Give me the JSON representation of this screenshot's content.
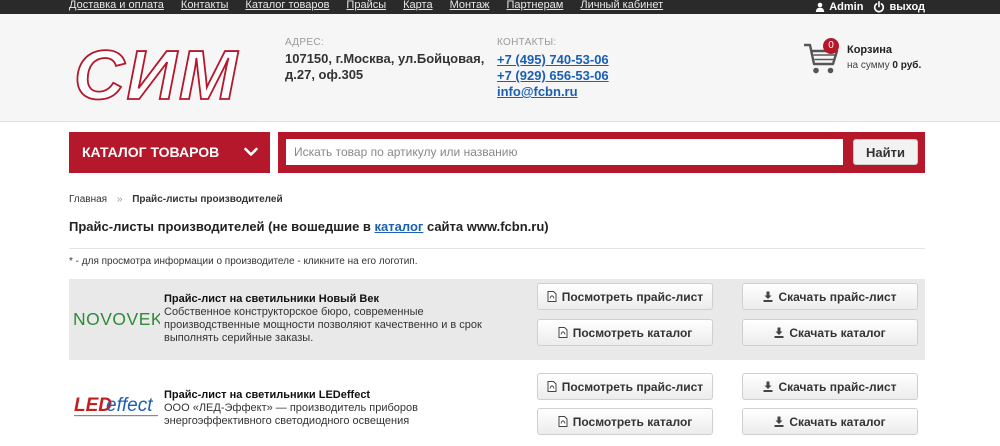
{
  "topnav": {
    "items": [
      "Доставка и оплата",
      "Контакты",
      "Каталог товаров",
      "Прайсы",
      "Карта",
      "Монтаж",
      "Партнерам",
      "Личный кабинет"
    ],
    "user": "Admin",
    "logout": "выход"
  },
  "header": {
    "logo_text": "СИМ",
    "address_label": "АДРЕС:",
    "address": "107150, г.Москва, ул.Бойцовая, д.27, оф.305",
    "contacts_label": "КОНТАКТЫ:",
    "phone1": "+7 (495) 740-53-06",
    "phone2": "+7 (929) 656-53-06",
    "email": "info@fcbn.ru",
    "cart_count": "0",
    "cart_title": "Корзина",
    "cart_sum_prefix": "на сумму",
    "cart_sum": "0 руб."
  },
  "catalog_button": "КАТАЛОГ ТОВАРОВ",
  "search": {
    "placeholder": "Искать товар по артикулу или названию",
    "button": "Найти"
  },
  "breadcrumb": {
    "home": "Главная",
    "separator": "»",
    "current": "Прайс-листы производителей"
  },
  "page": {
    "title_start": "Прайс-листы производителей (не вошедшие в ",
    "title_link": "каталог",
    "title_end": " сайта www.fcbn.ru)",
    "note": "* - для просмотра информации о производителе - кликните на его логотип."
  },
  "manufacturers": [
    {
      "logo_text": "NOVOVEK",
      "name": "Прайс-лист на светильники Новый Век",
      "description": "Собственное конструкторское бюро, современные производственные мощности позволяют качественно и в срок выполнять серийные заказы."
    },
    {
      "logo_text_1": "LED",
      "logo_text_2": "effect",
      "name": "Прайс-лист на светильники LEDeffect",
      "description": "ООО «ЛЕД-Эффект» — производитель приборов энергоэффективного светодиодного освещения"
    }
  ],
  "buttons": {
    "view_price": "Посмотреть прайс-лист",
    "download_price": "Скачать прайс-лист",
    "view_catalog": "Посмотреть каталог",
    "download_catalog": "Скачать каталог"
  },
  "colors": {
    "brand_red": "#b5172b",
    "link_blue": "#1a5fb4",
    "topbar": "#2a2a2a"
  },
  "icons": {
    "user": "user-icon",
    "power": "power-icon",
    "cart": "cart-icon",
    "chevron": "chevron-down-icon",
    "pdf": "pdf-file-icon",
    "download": "download-icon"
  }
}
